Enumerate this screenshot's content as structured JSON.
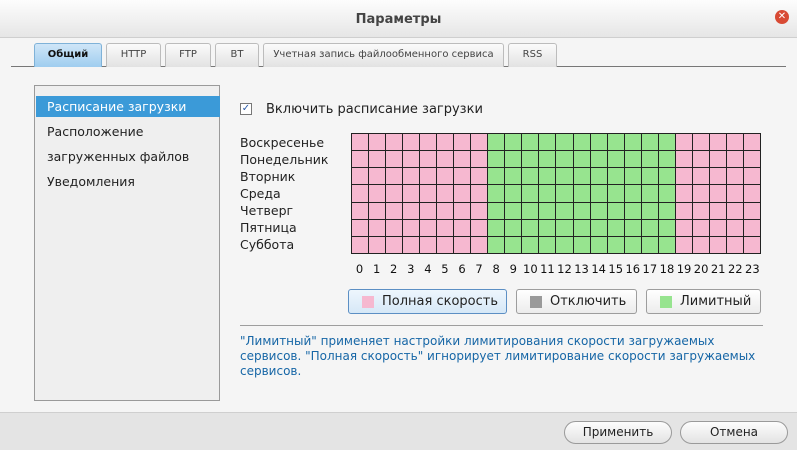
{
  "window": {
    "title": "Параметры"
  },
  "tabs": [
    {
      "label": "Общий"
    },
    {
      "label": "HTTP"
    },
    {
      "label": "FTP"
    },
    {
      "label": "BT"
    },
    {
      "label": "Учетная запись файлообменного сервиса"
    },
    {
      "label": "RSS"
    }
  ],
  "sidebar": {
    "items": [
      {
        "label": "Расписание загрузки"
      },
      {
        "label": "Расположение"
      },
      {
        "label": "загруженных файлов"
      },
      {
        "label": "Уведомления"
      }
    ]
  },
  "schedule": {
    "enable_label": "Включить расписание загрузки",
    "enabled": true,
    "days": [
      "Воскресенье",
      "Понедельник",
      "Вторник",
      "Среда",
      "Четверг",
      "Пятница",
      "Суббота"
    ],
    "hours": [
      "0",
      "1",
      "2",
      "3",
      "4",
      "5",
      "6",
      "7",
      "8",
      "9",
      "10",
      "11",
      "12",
      "13",
      "14",
      "15",
      "16",
      "17",
      "18",
      "19",
      "20",
      "21",
      "22",
      "23"
    ],
    "hour_modes": [
      "full",
      "full",
      "full",
      "full",
      "full",
      "full",
      "full",
      "full",
      "limited",
      "limited",
      "limited",
      "limited",
      "limited",
      "limited",
      "limited",
      "limited",
      "limited",
      "limited",
      "limited",
      "full",
      "full",
      "full",
      "full",
      "full"
    ],
    "colors": {
      "full": "#f6b8d0",
      "off": "#9a9a9a",
      "limited": "#97e48f"
    }
  },
  "legend": {
    "full_label": "Полная скорость",
    "off_label": "Отключить",
    "limited_label": "Лимитный"
  },
  "note": "\"Лимитный\" применяет настройки лимитирования скорости загружаемых сервисов. \"Полная скорость\" игнорирует лимитирование скорости загружаемых сервисов.",
  "footer": {
    "apply_label": "Применить",
    "cancel_label": "Отмена"
  }
}
